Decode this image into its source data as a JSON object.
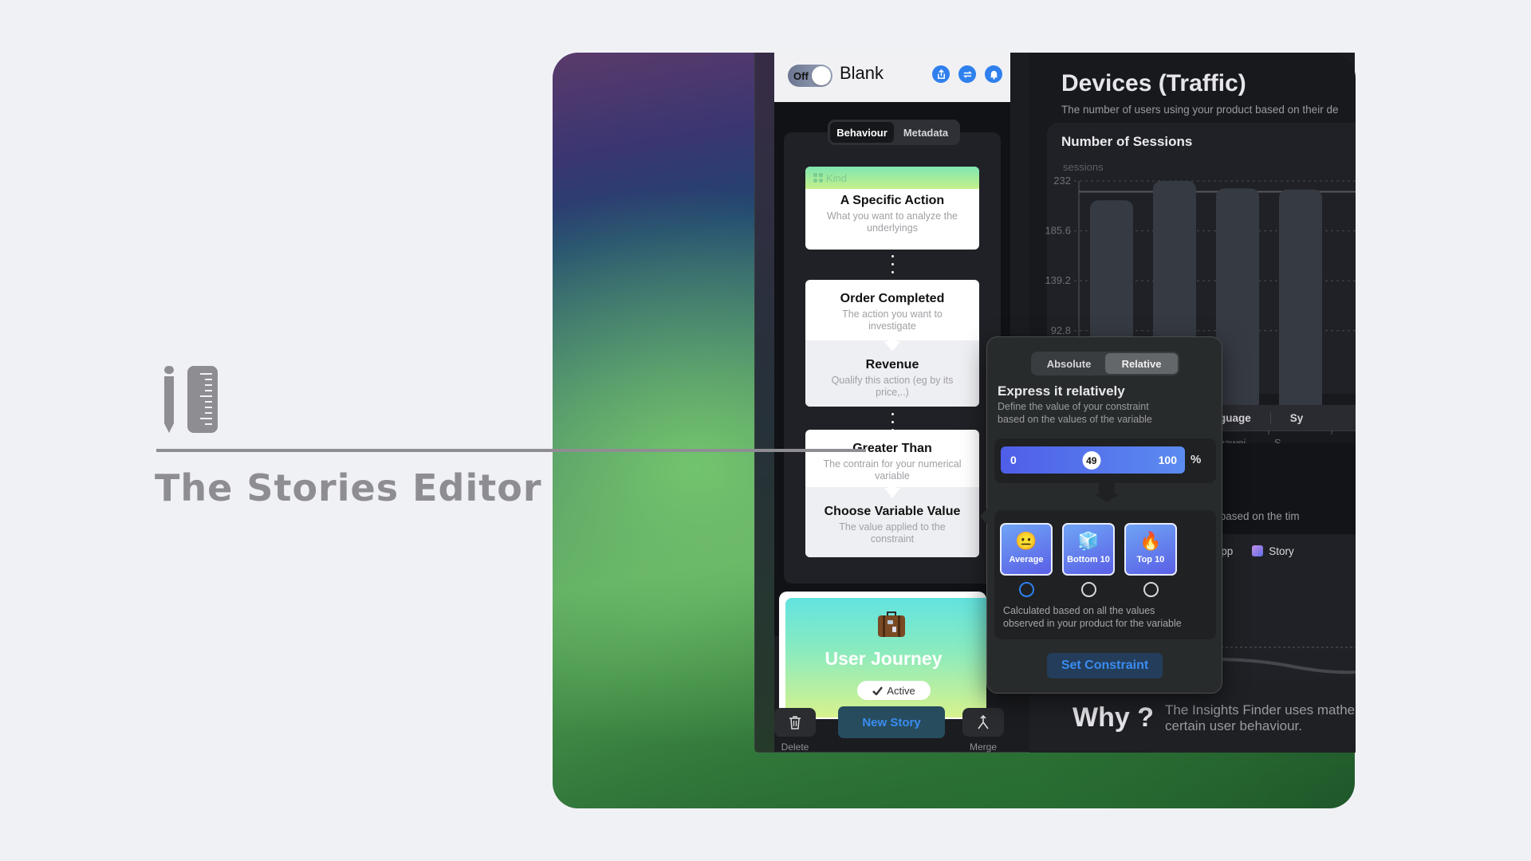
{
  "caption": {
    "icon": "pencil-and-ruler-icon",
    "title": "The Stories Editor"
  },
  "topbar": {
    "toggle_label": "Off",
    "toggle_on": false,
    "story_title": "Blank",
    "icons": [
      "share-icon",
      "sync-icon",
      "bell-icon"
    ]
  },
  "editor": {
    "tabs": [
      {
        "label": "Behaviour",
        "active": true
      },
      {
        "label": "Metadata",
        "active": false
      }
    ],
    "kind_label": "Kind",
    "cards": [
      {
        "title": "A Specific Action",
        "desc": "What you want to analyze the underlyings"
      },
      {
        "title": "Order Completed",
        "desc": "The action you want to investigate"
      },
      {
        "title": "Revenue",
        "desc": "Qualify this action (eg by its price,..)"
      },
      {
        "title": "Greater Than",
        "desc": "The contrain for your numerical variable"
      },
      {
        "title": "Choose Variable Value",
        "desc": "The value applied to the constraint"
      }
    ]
  },
  "journey": {
    "icon": "suitcase-icon",
    "title": "User Journey",
    "status": "Active"
  },
  "bottom_bar": {
    "delete_label": "Delete",
    "new_story_label": "New Story",
    "merge_label": "Merge"
  },
  "popover": {
    "modes": [
      {
        "label": "Absolute",
        "active": false
      },
      {
        "label": "Relative",
        "active": true
      }
    ],
    "heading": "Express it relatively",
    "description_line1": "Define the value of your constraint",
    "description_line2": "based on the values of the variable",
    "slider": {
      "min": "0",
      "max": "100",
      "value": 49,
      "unit": "%"
    },
    "choices": [
      {
        "label": "Average",
        "emoji": "😐",
        "selected": true
      },
      {
        "label": "Bottom 10",
        "emoji": "🧊",
        "selected": false
      },
      {
        "label": "Top 10",
        "emoji": "🔥",
        "selected": false
      }
    ],
    "note_line1": "Calculated based on all the values",
    "note_line2": "observed in your product for the variable",
    "set_button": "Set Constraint"
  },
  "dashboard": {
    "title": "Devices (Traffic)",
    "subtitle": "The number of users using your product based on their de",
    "sections_tabs": [
      "Language",
      "Sy"
    ],
    "timeline_subtitle": "product based on the tim",
    "legend": [
      {
        "label": "Whole App"
      },
      {
        "label": "Story"
      }
    ],
    "why_title": "Why ?",
    "why_line1": "The Insights Finder uses mathe",
    "why_line2": "certain user behaviour."
  },
  "chart_data": {
    "type": "bar",
    "title": "Number of Sessions",
    "ylabel": "sessions",
    "yticks": [
      92.8,
      139.2,
      185.6,
      232
    ],
    "ylim": [
      0,
      232
    ],
    "categories": [
      "",
      "",
      "Huawei",
      "S"
    ],
    "values": [
      214,
      232,
      225,
      224
    ],
    "reference_line": 222,
    "grid": true
  }
}
